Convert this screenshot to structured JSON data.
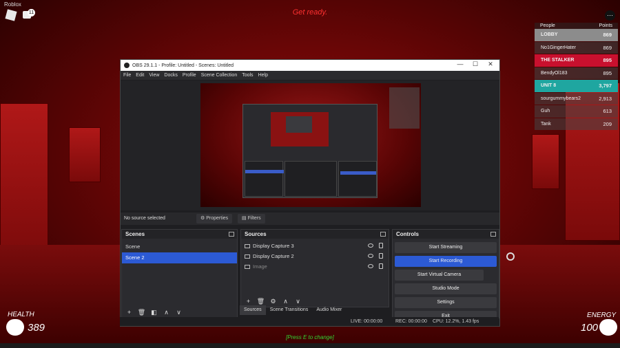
{
  "roblox": {
    "window_title": "Roblox",
    "chat_badge": "11",
    "menu_icon": "ellipsis-icon",
    "status_message": "Get ready.",
    "hint": "[Press E to change]",
    "health_label": "HEALTH",
    "health_value": "389",
    "energy_label": "ENERGY",
    "energy_value": "100",
    "leaderboard": {
      "col_people": "People",
      "col_points": "Points",
      "rows": [
        {
          "name": "LOBBY",
          "points": "869",
          "team": true,
          "color": "#8c8c8c"
        },
        {
          "name": "No1GingerHater",
          "points": "869",
          "team": false,
          "color": ""
        },
        {
          "name": "THE STALKER",
          "points": "895",
          "team": true,
          "color": "#c8102e"
        },
        {
          "name": "BendyOl183",
          "points": "895",
          "team": false,
          "color": ""
        },
        {
          "name": "UNIT 8",
          "points": "3,797",
          "team": true,
          "color": "#1fa6a0"
        },
        {
          "name": "sourgummybears2",
          "points": "2,913",
          "team": false,
          "color": ""
        },
        {
          "name": "Guh",
          "points": "613",
          "team": false,
          "color": ""
        },
        {
          "name": "Tank",
          "points": "209",
          "team": false,
          "color": ""
        }
      ]
    }
  },
  "obs": {
    "title": "OBS 29.1.1 - Profile: Untitled - Scenes: Untitled",
    "menu": [
      "File",
      "Edit",
      "View",
      "Docks",
      "Profile",
      "Scene Collection",
      "Tools",
      "Help"
    ],
    "no_source": "No source selected",
    "properties": "Properties",
    "filters": "Filters",
    "scenes": {
      "title": "Scenes",
      "items": [
        "Scene",
        "Scene 2"
      ],
      "selected": 1
    },
    "sources": {
      "title": "Sources",
      "items": [
        {
          "name": "Display Capture 3",
          "visible": true
        },
        {
          "name": "Display Capture 2",
          "visible": true
        },
        {
          "name": "Image",
          "visible": false
        }
      ]
    },
    "controls": {
      "title": "Controls",
      "buttons": [
        "Start Streaming",
        "Start Recording",
        "Start Virtual Camera",
        "Studio Mode",
        "Settings",
        "Exit"
      ]
    },
    "tabs": [
      "Sources",
      "Scene Transitions",
      "Audio Mixer"
    ],
    "status": {
      "live": "LIVE: 00:00:00",
      "rec": "REC: 00:00:00",
      "cpu": "CPU: 12.2%, 1.43 fps"
    }
  }
}
